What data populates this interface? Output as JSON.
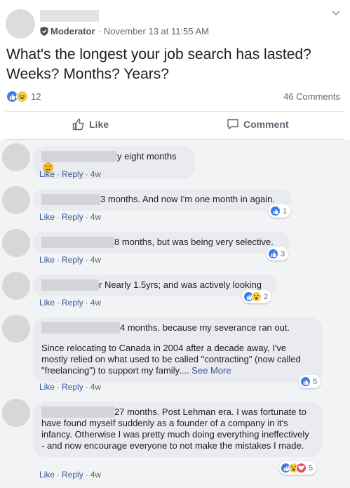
{
  "post": {
    "author_role": "Moderator",
    "separator": "·",
    "timestamp": "November 13 at 11:55 AM",
    "text_line1": "What's the longest your job search has lasted?",
    "text_line2": "Weeks? Months? Years?",
    "reaction_count": "12",
    "comment_count": "46 Comments",
    "reaction_icons": [
      "like-icon",
      "haha-icon"
    ]
  },
  "actions": {
    "like_label": "Like",
    "comment_label": "Comment"
  },
  "comments": [
    {
      "text": "y eight months",
      "has_emoji": true,
      "emoji_name": "persevering-face-icon",
      "like": "Like",
      "reply": "Reply",
      "dot": "·",
      "time": "4w"
    },
    {
      "text": "3 months. And now I'm one month in again.",
      "like": "Like",
      "reply": "Reply",
      "dot": "·",
      "time": "4w",
      "reaction_count": "1",
      "reaction_icons": [
        "like-icon"
      ]
    },
    {
      "text": "8 months, but was being very selective.",
      "like": "Like",
      "reply": "Reply",
      "dot": "·",
      "time": "4w",
      "reaction_count": "3",
      "reaction_icons": [
        "like-icon"
      ]
    },
    {
      "text": "r Nearly 1.5yrs; and was actively looking",
      "like": "Like",
      "reply": "Reply",
      "dot": "·",
      "time": "4w",
      "reaction_count": "2",
      "reaction_icons": [
        "like-icon",
        "wow-icon"
      ]
    },
    {
      "text": "4 months, because my severance ran out.",
      "text2": "Since relocating to Canada in 2004 after a decade away, I've mostly relied on what used to be called \"contracting\" (now called \"freelancing\") to support my family....",
      "see_more": "See More",
      "like": "Like",
      "reply": "Reply",
      "dot": "·",
      "time": "4w",
      "reaction_count": "5",
      "reaction_icons": [
        "like-icon"
      ]
    },
    {
      "text": "27 months. Post Lehman era. I was fortunate to have found myself suddenly as a founder of a company in it's infancy. Otherwise I was pretty much doing everything ineffectively - and now encourage everyone to not make the mistakes I made.",
      "like": "Like",
      "reply": "Reply",
      "dot": "·",
      "time": "4w",
      "reaction_count": "5",
      "reaction_icons": [
        "like-icon",
        "wow-icon",
        "love-icon"
      ]
    }
  ],
  "colors": {
    "link": "#385898",
    "like_blue": "#3b7bf0",
    "bubble_bg": "#e9ebee",
    "comments_bg": "#f2f3f5"
  }
}
